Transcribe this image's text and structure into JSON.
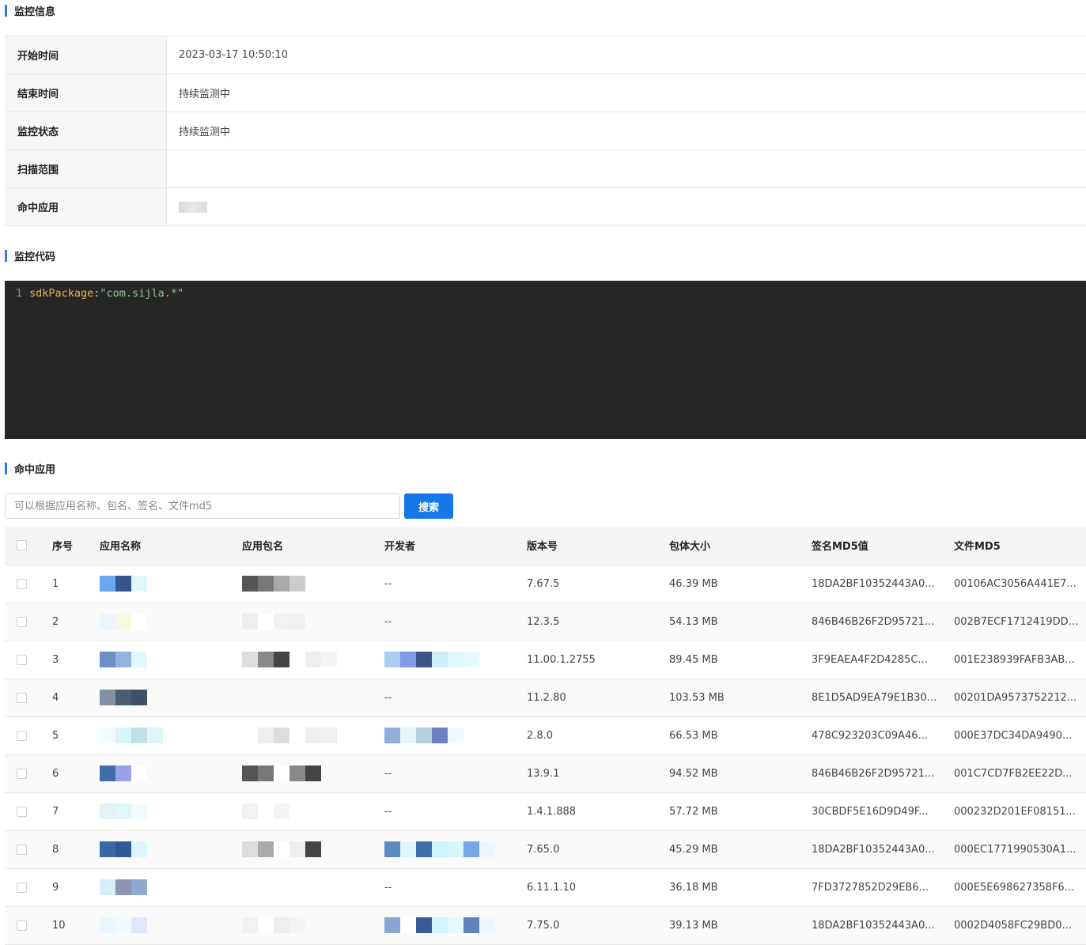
{
  "sections": {
    "monitor_info": "监控信息",
    "monitor_code": "监控代码",
    "hit_apps": "命中应用"
  },
  "info_rows": [
    {
      "label": "开始时间",
      "value": "2023-03-17 10:50:10"
    },
    {
      "label": "结束时间",
      "value": "持续监测中"
    },
    {
      "label": "监控状态",
      "value": "持续监测中"
    },
    {
      "label": "扫描范围",
      "value": ""
    },
    {
      "label": "命中应用",
      "value": ""
    }
  ],
  "code": {
    "line_number": "1",
    "key": "sdkPackage",
    "colon": ":",
    "value": "\"com.sijla.*\""
  },
  "search": {
    "placeholder": "可以根据应用名称、包名、签名、文件md5",
    "button_label": "搜索"
  },
  "table": {
    "columns": [
      "序号",
      "应用名称",
      "应用包名",
      "开发者",
      "版本号",
      "包体大小",
      "签名MD5值",
      "文件MD5"
    ],
    "rows": [
      {
        "index": "1",
        "developer": "--",
        "version": "7.67.5",
        "size": "46.39 MB",
        "sign_md5": "18DA2BF10352443A0...",
        "file_md5": "00106AC3056A441E7..."
      },
      {
        "index": "2",
        "developer": "--",
        "version": "12.3.5",
        "size": "54.13 MB",
        "sign_md5": "846B46B26F2D95721...",
        "file_md5": "002B7ECF1712419DD..."
      },
      {
        "index": "3",
        "developer": "",
        "version": "11.00.1.2755",
        "size": "89.45 MB",
        "sign_md5": "3F9EAEA4F2D4285C...",
        "file_md5": "001E238939FAFB3AB..."
      },
      {
        "index": "4",
        "developer": "--",
        "version": "11.2.80",
        "size": "103.53 MB",
        "sign_md5": "8E1D5AD9EA79E1B30...",
        "file_md5": "00201DA9573752212..."
      },
      {
        "index": "5",
        "developer": "",
        "version": "2.8.0",
        "size": "66.53 MB",
        "sign_md5": "478C923203C09A46...",
        "file_md5": "000E37DC34DA9490..."
      },
      {
        "index": "6",
        "developer": "--",
        "version": "13.9.1",
        "size": "94.52 MB",
        "sign_md5": "846B46B26F2D95721...",
        "file_md5": "001C7CD7FB2EE22D..."
      },
      {
        "index": "7",
        "developer": "--",
        "version": "1.4.1.888",
        "size": "57.72 MB",
        "sign_md5": "30CBDF5E16D9D49F...",
        "file_md5": "000232D201EF08151..."
      },
      {
        "index": "8",
        "developer": "",
        "version": "7.65.0",
        "size": "45.29 MB",
        "sign_md5": "18DA2BF10352443A0...",
        "file_md5": "000EC1771990530A1..."
      },
      {
        "index": "9",
        "developer": "--",
        "version": "6.11.1.10",
        "size": "36.18 MB",
        "sign_md5": "7FD3727852D29EB6...",
        "file_md5": "000E5E698627358F6..."
      },
      {
        "index": "10",
        "developer": "",
        "version": "7.75.0",
        "size": "39.13 MB",
        "sign_md5": "18DA2BF10352443A0...",
        "file_md5": "0002D4058FC29BD0..."
      }
    ]
  },
  "redaction_colors": {
    "app_name": [
      [
        "#6aa7f0",
        "#33578c",
        "#e0f7ff"
      ],
      [
        "#eef5ff",
        "#f4fbe0",
        "#ffffff"
      ],
      [
        "#6b8fc4",
        "#8fb4e0",
        "#e0f8ff"
      ],
      [
        "#8190a3",
        "#4b5d72",
        "#3f5068"
      ],
      [
        "#f4fbff",
        "#d9f4fb",
        "#bfe0e8",
        "#dff4fa"
      ],
      [
        "#3f6da8",
        "#9aa0e6",
        "#ffffff"
      ],
      [
        "#e5f1f6",
        "#dff7fb",
        "#f2fbfd"
      ],
      [
        "#3a67a6",
        "#2f5a96",
        "#dff5ff"
      ],
      [
        "#d6eefa",
        "#8b97b0",
        "#8fa8d0"
      ],
      [
        "#e6fafd",
        "#effcff",
        "#e5e6fb"
      ]
    ],
    "package": [
      [
        "#555555",
        "#777777",
        "#aaaaaa",
        "#cccccc"
      ],
      [
        "#eeeeee",
        "#ffffff",
        "#f3f3f3",
        "#f0f0f0"
      ],
      [
        "#dddddd",
        "#888888",
        "#444444",
        "#ffffff",
        "#eeeeee",
        "#f5f5f5"
      ],
      [],
      [
        "#ffffff",
        "#eeeeee",
        "#dddddd",
        "#ffffff",
        "#eeeeee",
        "#f0f0f0"
      ],
      [
        "#555555",
        "#777777",
        "#ffffff",
        "#888888",
        "#444444"
      ],
      [
        "#f2f2f2",
        "#ffffff",
        "#f5f5f5"
      ],
      [
        "#dddddd",
        "#aaaaaa",
        "#ffffff",
        "#eeeeee",
        "#444444"
      ],
      [],
      [
        "#f2f2f2",
        "#ffffff",
        "#eeeeee",
        "#f5f5f5"
      ]
    ],
    "developer": [
      [],
      [],
      [
        "#a9cdf4",
        "#7f9be6",
        "#3a5589",
        "#cdeffa",
        "#def7fb",
        "#e6fbfd"
      ],
      [],
      [
        "#8fb0de",
        "#e6f4f8",
        "#b7d0e0",
        "#6f80c0",
        "#f1f8ff"
      ],
      [],
      [],
      [
        "#5d8ac0",
        "#dcf6fb",
        "#3f6fa8",
        "#cdf5fb",
        "#d6f6fc",
        "#7aa4e8",
        "#f1f6fc"
      ],
      [],
      [
        "#87a8d4",
        "#ffffff",
        "#3a5a92",
        "#d3f4fb",
        "#e6fafd",
        "#5e83b6",
        "#eef7fb"
      ]
    ]
  }
}
